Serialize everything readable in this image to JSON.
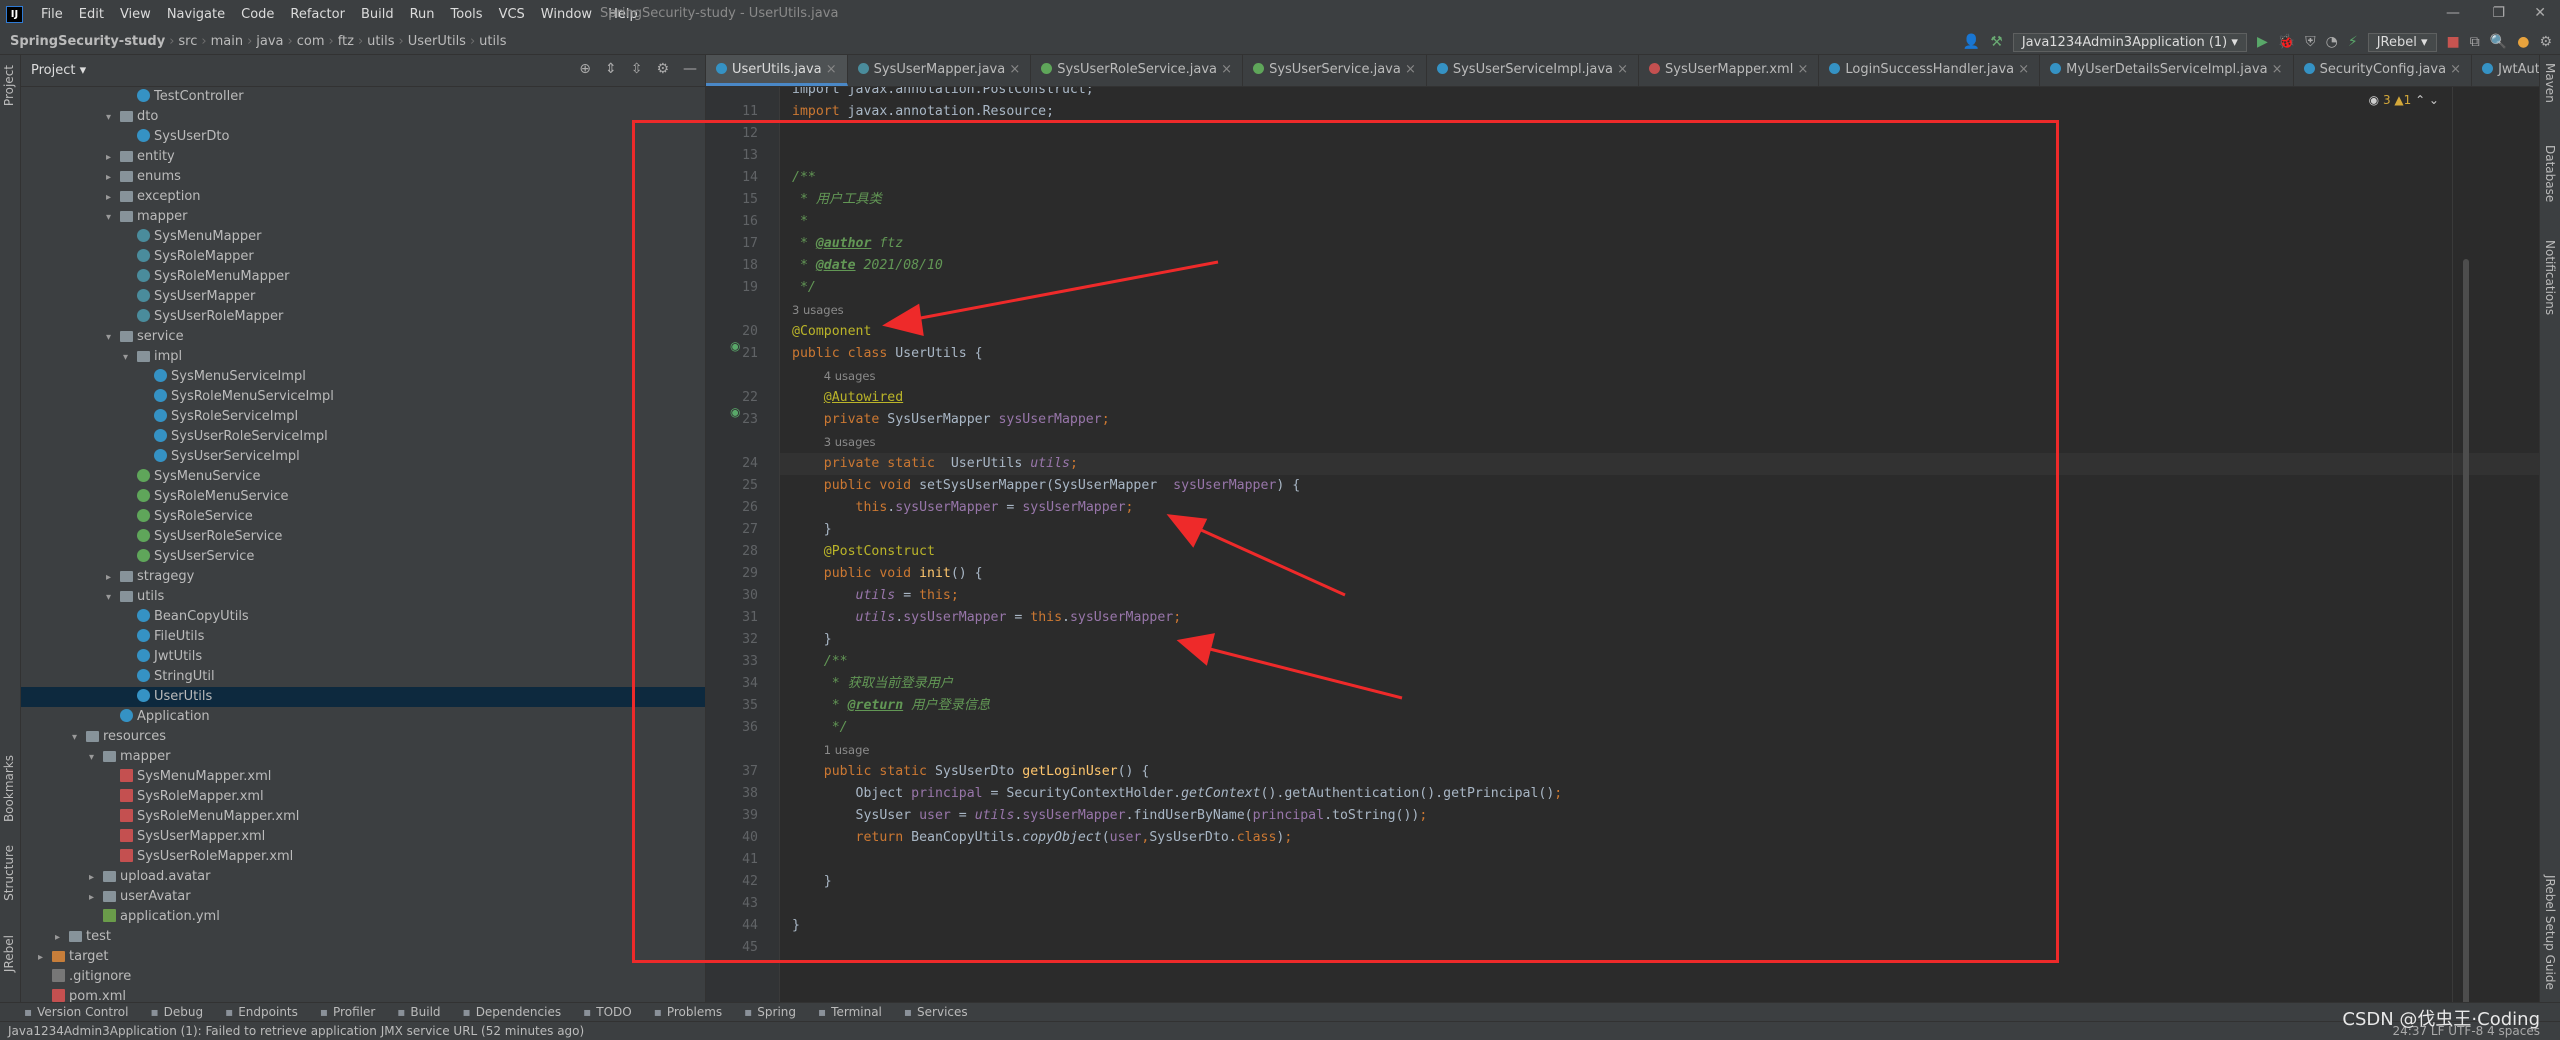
{
  "menubar": {
    "items": [
      "File",
      "Edit",
      "View",
      "Navigate",
      "Code",
      "Refactor",
      "Build",
      "Run",
      "Tools",
      "VCS",
      "Window",
      "Help"
    ],
    "window_title": "SpringSecurity-study - UserUtils.java"
  },
  "navbar": {
    "crumbs": [
      "SpringSecurity-study",
      "src",
      "main",
      "java",
      "com",
      "ftz",
      "utils",
      "UserUtils",
      "utils"
    ],
    "run_config": "Java1234Admin3Application (1)",
    "jrebel": "JRebel"
  },
  "project": {
    "title": "Project",
    "tree": [
      {
        "label": "TestController",
        "depth": 6,
        "icon": "cls",
        "arrow": ""
      },
      {
        "label": "dto",
        "depth": 5,
        "icon": "folder",
        "arrow": "v"
      },
      {
        "label": "SysUserDto",
        "depth": 6,
        "icon": "cls",
        "arrow": ""
      },
      {
        "label": "entity",
        "depth": 5,
        "icon": "folder",
        "arrow": ">"
      },
      {
        "label": "enums",
        "depth": 5,
        "icon": "folder",
        "arrow": ">"
      },
      {
        "label": "exception",
        "depth": 5,
        "icon": "folder",
        "arrow": ">"
      },
      {
        "label": "mapper",
        "depth": 5,
        "icon": "folder",
        "arrow": "v"
      },
      {
        "label": "SysMenuMapper",
        "depth": 6,
        "icon": "mapper",
        "arrow": ""
      },
      {
        "label": "SysRoleMapper",
        "depth": 6,
        "icon": "mapper",
        "arrow": ""
      },
      {
        "label": "SysRoleMenuMapper",
        "depth": 6,
        "icon": "mapper",
        "arrow": ""
      },
      {
        "label": "SysUserMapper",
        "depth": 6,
        "icon": "mapper",
        "arrow": ""
      },
      {
        "label": "SysUserRoleMapper",
        "depth": 6,
        "icon": "mapper",
        "arrow": ""
      },
      {
        "label": "service",
        "depth": 5,
        "icon": "folder",
        "arrow": "v"
      },
      {
        "label": "impl",
        "depth": 6,
        "icon": "folder",
        "arrow": "v"
      },
      {
        "label": "SysMenuServiceImpl",
        "depth": 7,
        "icon": "cls",
        "arrow": ""
      },
      {
        "label": "SysRoleMenuServiceImpl",
        "depth": 7,
        "icon": "cls",
        "arrow": ""
      },
      {
        "label": "SysRoleServiceImpl",
        "depth": 7,
        "icon": "cls",
        "arrow": ""
      },
      {
        "label": "SysUserRoleServiceImpl",
        "depth": 7,
        "icon": "cls",
        "arrow": ""
      },
      {
        "label": "SysUserServiceImpl",
        "depth": 7,
        "icon": "cls",
        "arrow": ""
      },
      {
        "label": "SysMenuService",
        "depth": 6,
        "icon": "iface",
        "arrow": ""
      },
      {
        "label": "SysRoleMenuService",
        "depth": 6,
        "icon": "iface",
        "arrow": ""
      },
      {
        "label": "SysRoleService",
        "depth": 6,
        "icon": "iface",
        "arrow": ""
      },
      {
        "label": "SysUserRoleService",
        "depth": 6,
        "icon": "iface",
        "arrow": ""
      },
      {
        "label": "SysUserService",
        "depth": 6,
        "icon": "iface",
        "arrow": ""
      },
      {
        "label": "stragegy",
        "depth": 5,
        "icon": "folder",
        "arrow": ">"
      },
      {
        "label": "utils",
        "depth": 5,
        "icon": "folder",
        "arrow": "v"
      },
      {
        "label": "BeanCopyUtils",
        "depth": 6,
        "icon": "cls",
        "arrow": ""
      },
      {
        "label": "FileUtils",
        "depth": 6,
        "icon": "cls",
        "arrow": ""
      },
      {
        "label": "JwtUtils",
        "depth": 6,
        "icon": "cls",
        "arrow": ""
      },
      {
        "label": "StringUtil",
        "depth": 6,
        "icon": "cls",
        "arrow": ""
      },
      {
        "label": "UserUtils",
        "depth": 6,
        "icon": "cls",
        "arrow": "",
        "selected": true
      },
      {
        "label": "Application",
        "depth": 5,
        "icon": "cls",
        "arrow": ""
      },
      {
        "label": "resources",
        "depth": 3,
        "icon": "folder",
        "arrow": "v"
      },
      {
        "label": "mapper",
        "depth": 4,
        "icon": "folder",
        "arrow": "v"
      },
      {
        "label": "SysMenuMapper.xml",
        "depth": 5,
        "icon": "xml",
        "arrow": ""
      },
      {
        "label": "SysRoleMapper.xml",
        "depth": 5,
        "icon": "xml",
        "arrow": ""
      },
      {
        "label": "SysRoleMenuMapper.xml",
        "depth": 5,
        "icon": "xml",
        "arrow": ""
      },
      {
        "label": "SysUserMapper.xml",
        "depth": 5,
        "icon": "xml",
        "arrow": ""
      },
      {
        "label": "SysUserRoleMapper.xml",
        "depth": 5,
        "icon": "xml",
        "arrow": ""
      },
      {
        "label": "upload.avatar",
        "depth": 4,
        "icon": "folder",
        "arrow": ">"
      },
      {
        "label": "userAvatar",
        "depth": 4,
        "icon": "folder",
        "arrow": ">"
      },
      {
        "label": "application.yml",
        "depth": 4,
        "icon": "yml",
        "arrow": ""
      },
      {
        "label": "test",
        "depth": 2,
        "icon": "folder",
        "arrow": ">"
      },
      {
        "label": "target",
        "depth": 1,
        "icon": "folder-orange",
        "arrow": ">"
      },
      {
        "label": ".gitignore",
        "depth": 1,
        "icon": "git",
        "arrow": ""
      },
      {
        "label": "pom.xml",
        "depth": 1,
        "icon": "xml",
        "arrow": ""
      }
    ]
  },
  "tabs": [
    {
      "label": "UserUtils.java",
      "active": true,
      "color": "#3592c4"
    },
    {
      "label": "SysUserMapper.java",
      "color": "#4a8c9c"
    },
    {
      "label": "SysUserRoleService.java",
      "color": "#5fa65a"
    },
    {
      "label": "SysUserService.java",
      "color": "#5fa65a"
    },
    {
      "label": "SysUserServiceImpl.java",
      "color": "#3592c4"
    },
    {
      "label": "SysUserMapper.xml",
      "color": "#c45050"
    },
    {
      "label": "LoginSuccessHandler.java",
      "color": "#3592c4"
    },
    {
      "label": "MyUserDetailsServiceImpl.java",
      "color": "#3592c4"
    },
    {
      "label": "SecurityConfig.java",
      "color": "#3592c4"
    },
    {
      "label": "JwtAuthenticationFilter.java",
      "color": "#3592c4"
    }
  ],
  "editor": {
    "inspection": "3 ▲1",
    "lines": [
      {
        "n": "",
        "h": "<span class=\"pl\">import javax.annotation.PostConstruct;</span>"
      },
      {
        "n": "11",
        "h": "<span class=\"k\">import</span> <span class=\"pl\">javax.annotation.Resource;</span>"
      },
      {
        "n": "12",
        "h": ""
      },
      {
        "n": "13",
        "h": ""
      },
      {
        "n": "14",
        "h": "<span class=\"cm\">/**</span>"
      },
      {
        "n": "15",
        "h": "<span class=\"cm\"> * 用户工具类</span>"
      },
      {
        "n": "16",
        "h": "<span class=\"cm\"> *</span>"
      },
      {
        "n": "17",
        "h": "<span class=\"cm\"> * <b><u>@author</u></b> ftz</span>"
      },
      {
        "n": "18",
        "h": "<span class=\"cm\"> * <b><u>@date</u></b> 2021/08/10</span>"
      },
      {
        "n": "19",
        "h": "<span class=\"cm\"> */</span>"
      },
      {
        "n": "",
        "h": "<span class=\"hint\">3 usages</span>"
      },
      {
        "n": "20",
        "h": "<span class=\"a\">@Component</span>"
      },
      {
        "n": "21",
        "h": "<span class=\"k\">public class</span> <span class=\"pl\">UserUtils {</span>"
      },
      {
        "n": "",
        "h": "    <span class=\"hint\">4 usages</span>"
      },
      {
        "n": "22",
        "h": "    <span class=\"a\"><u>@Autowired</u></span>"
      },
      {
        "n": "23",
        "h": "    <span class=\"k\">private</span> <span class=\"pl\">SysUserMapper</span> <span class=\"f\">sysUserMapper</span><span class=\"k\">;</span>"
      },
      {
        "n": "",
        "h": "    <span class=\"hint\">3 usages</span>"
      },
      {
        "n": "24",
        "cur": true,
        "h": "    <span class=\"k\">private static</span>  <span class=\"pl\">UserUtils</span> <span class=\"fi\">utils</span><span class=\"k\">;</span>"
      },
      {
        "n": "25",
        "h": "    <span class=\"k\">public void</span> <span class=\"pl\">setSysUserMapper(SysUserMapper</span>  <span class=\"f\">sysUserMapper</span><span class=\"pl\">) {</span>"
      },
      {
        "n": "26",
        "h": "        <span class=\"k\">this</span><span class=\"pl\">.</span><span class=\"f\">sysUserMapper</span> <span class=\"pl\">=</span> <span class=\"f\">sysUserMapper</span><span class=\"k\">;</span>"
      },
      {
        "n": "27",
        "h": "    <span class=\"pl\">}</span>"
      },
      {
        "n": "28",
        "h": "    <span class=\"a\">@PostConstruct</span>"
      },
      {
        "n": "29",
        "h": "    <span class=\"k\">public void</span> <span class=\"mt\">init</span><span class=\"pl\">() {</span>"
      },
      {
        "n": "30",
        "h": "        <span class=\"fi\">utils</span> <span class=\"pl\">=</span> <span class=\"k\">this;</span>"
      },
      {
        "n": "31",
        "h": "        <span class=\"fi\">utils</span><span class=\"pl\">.</span><span class=\"f\">sysUserMapper</span> <span class=\"pl\">=</span> <span class=\"k\">this</span><span class=\"pl\">.</span><span class=\"f\">sysUserMapper</span><span class=\"k\">;</span>"
      },
      {
        "n": "32",
        "h": "    <span class=\"pl\">}</span>"
      },
      {
        "n": "33",
        "h": "    <span class=\"cm\">/**</span>"
      },
      {
        "n": "34",
        "h": "<span class=\"cm\">     * 获取当前登录用户</span>"
      },
      {
        "n": "35",
        "h": "<span class=\"cm\">     * <b><u>@return</u></b> 用户登录信息</span>"
      },
      {
        "n": "36",
        "h": "<span class=\"cm\">     */</span>"
      },
      {
        "n": "",
        "h": "    <span class=\"hint\">1 usage</span>"
      },
      {
        "n": "37",
        "h": "    <span class=\"k\">public static</span> <span class=\"pl\">SysUserDto</span> <span class=\"mt\">getLoginUser</span><span class=\"pl\">() {</span>"
      },
      {
        "n": "38",
        "h": "        <span class=\"pl\">Object</span> <span class=\"f\">principal</span> <span class=\"pl\">= SecurityContextHolder.</span><span class=\"pl it\">getContext</span><span class=\"pl\">().getAuthentication().getPrincipal()</span><span class=\"k\">;</span>"
      },
      {
        "n": "39",
        "h": "        <span class=\"pl\">SysUser</span> <span class=\"f\">user</span> <span class=\"pl\">=</span> <span class=\"fi\">utils</span><span class=\"pl\">.</span><span class=\"f\">sysUserMapper</span><span class=\"pl\">.findUserByName(</span><span class=\"f\">principal</span><span class=\"pl\">.toString())</span><span class=\"k\">;</span>"
      },
      {
        "n": "40",
        "h": "        <span class=\"k\">return</span> <span class=\"pl\">BeanCopyUtils.</span><span class=\"pl it\">copyObject</span><span class=\"pl\">(</span><span class=\"f\">user</span><span class=\"k\">,</span><span class=\"pl\">SysUserDto.</span><span class=\"k\">class</span><span class=\"pl\">)</span><span class=\"k\">;</span>"
      },
      {
        "n": "41",
        "h": ""
      },
      {
        "n": "42",
        "h": "    <span class=\"pl\">}</span>"
      },
      {
        "n": "43",
        "h": ""
      },
      {
        "n": "44",
        "h": "<span class=\"pl\">}</span>"
      },
      {
        "n": "45",
        "h": ""
      }
    ]
  },
  "bottom_tools": [
    "Version Control",
    "Debug",
    "Endpoints",
    "Profiler",
    "Build",
    "Dependencies",
    "TODO",
    "Problems",
    "Spring",
    "Terminal",
    "Services"
  ],
  "status": {
    "message": "Java1234Admin3Application (1): Failed to retrieve application JMX service URL (52 minutes ago)",
    "right": "24:37  LF  UTF-8  4 spaces"
  },
  "sidestrip": {
    "left": [
      "Project",
      "Bookmarks",
      "Structure",
      "JRebel"
    ],
    "right": [
      "Maven",
      "Database",
      "Notifications",
      "JRebel Setup Guide"
    ]
  },
  "watermark": "CSDN @伐虫王·Coding"
}
